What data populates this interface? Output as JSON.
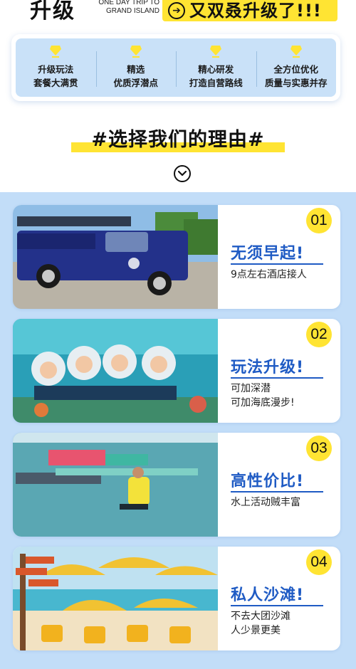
{
  "header": {
    "upgrade_word": "升级",
    "en_line1": "ONE DAY TRIP TO",
    "en_line2": "GRAND ISLAND",
    "banner_text": "又双叒升级了!!!",
    "arrow_icon": "circle-arrow-right-icon"
  },
  "features": [
    {
      "line1": "升级玩法",
      "line2": "套餐大满贯"
    },
    {
      "line1": "精选",
      "line2": "优质浮潜点"
    },
    {
      "line1": "精心研发",
      "line2": "打造自营路线"
    },
    {
      "line1": "全方位优化",
      "line2": "质量与实惠并存"
    }
  ],
  "reason": {
    "title": "#选择我们的理由#",
    "chevron_icon": "chevron-down-circle-icon"
  },
  "cards": [
    {
      "number": "01",
      "title": "无须早起!",
      "desc_line1": "9点左右酒店接人",
      "desc_line2": "",
      "photo": "pickup-truck-photo"
    },
    {
      "number": "02",
      "title": "玩法升级!",
      "desc_line1": "可加深潜",
      "desc_line2": "可加海底漫步!",
      "photo": "sea-walk-divers-photo"
    },
    {
      "number": "03",
      "title": "高性价比!",
      "desc_line1": "水上活动贼丰富",
      "desc_line2": "",
      "photo": "water-park-jump-photo"
    },
    {
      "number": "04",
      "title": "私人沙滩!",
      "desc_line1": "不去大团沙滩",
      "desc_line2": "人少景更美",
      "photo": "beach-umbrellas-photo"
    }
  ],
  "colors": {
    "accent_yellow": "#ffe433",
    "title_blue": "#1f5bc4",
    "section_blue": "#c2ddf8"
  }
}
